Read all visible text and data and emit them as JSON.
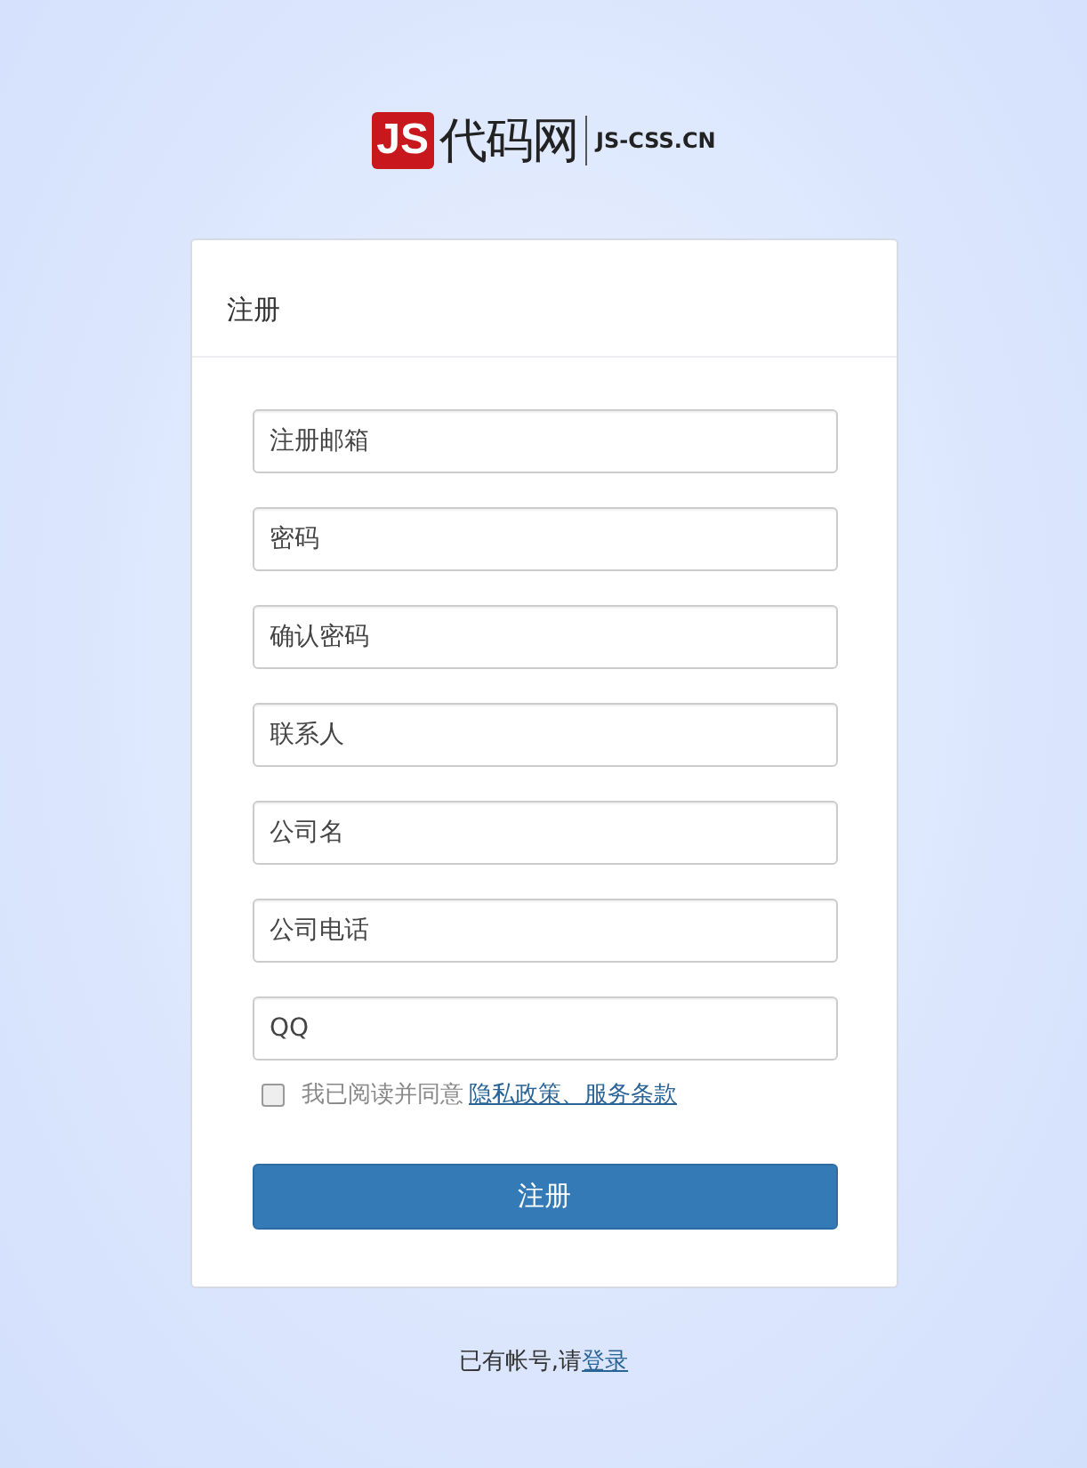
{
  "logo": {
    "badge": "JS",
    "name": "代码网",
    "domain": "JS-CSS.CN"
  },
  "form": {
    "title": "注册",
    "fields": [
      {
        "placeholder": "注册邮箱"
      },
      {
        "placeholder": "密码"
      },
      {
        "placeholder": "确认密码"
      },
      {
        "placeholder": "联系人"
      },
      {
        "placeholder": "公司名"
      },
      {
        "placeholder": "公司电话"
      },
      {
        "placeholder": "QQ"
      }
    ],
    "agreement": {
      "checked": false,
      "text": "我已阅读并同意",
      "link": "隐私政策、服务条款"
    },
    "submit": "注册"
  },
  "footer": {
    "text": "已有帐号,请",
    "link": "登录"
  }
}
